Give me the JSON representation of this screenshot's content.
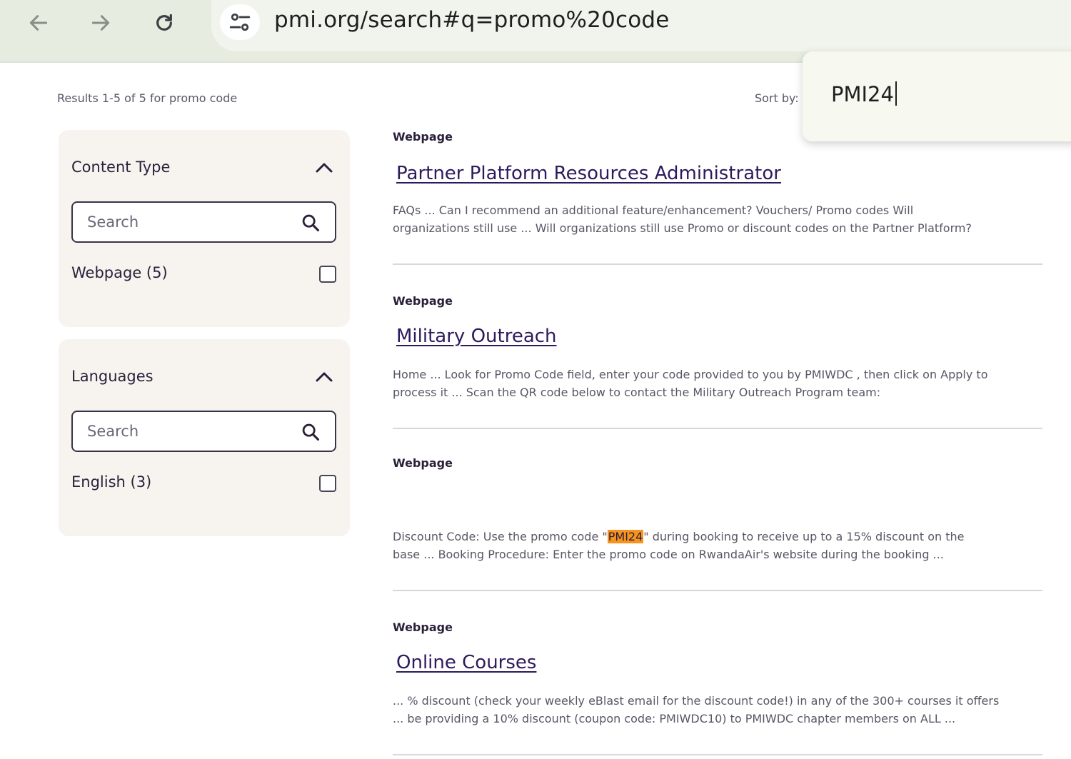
{
  "browser": {
    "url": "pmi.org/search#q=promo%20code",
    "icons": {
      "back": "arrow-left-icon",
      "forward": "arrow-right-icon",
      "reload": "reload-icon",
      "site_info": "tune-icon"
    }
  },
  "autofill": {
    "value": "PMI24"
  },
  "results_header": {
    "count_text": "Results 1-5 of 5 for promo code",
    "sort_label": "Sort by:"
  },
  "facets": [
    {
      "title": "Content Type",
      "search_placeholder": "Search",
      "options": [
        {
          "label": "Webpage (5)",
          "checked": false
        }
      ]
    },
    {
      "title": "Languages",
      "search_placeholder": "Search",
      "options": [
        {
          "label": "English (3)",
          "checked": false
        }
      ]
    }
  ],
  "results": [
    {
      "type": "Webpage",
      "title": "Partner Platform Resources Administrator",
      "snippet_line1": "FAQs ... Can I recommend an additional feature/enhancement? Vouchers/ Promo codes Will",
      "snippet_line2": "organizations still use ... Will organizations still use Promo or discount codes on the Partner Platform?"
    },
    {
      "type": "Webpage",
      "title": "Military Outreach",
      "snippet_line1": "Home ... Look for Promo Code field, enter your code provided to you by PMIWDC , then click on Apply to",
      "snippet_line2": "process it ... Scan the QR code below to contact the Military Outreach Program team:"
    },
    {
      "type": "Webpage",
      "title": "",
      "snippet_pre": "Discount Code: Use the promo code \"",
      "snippet_highlight": "PMI24",
      "snippet_post": "\" during booking to receive up to a 15% discount on the",
      "snippet_line2": "base ... Booking Procedure: Enter the promo code on RwandaAir's website during the booking ..."
    },
    {
      "type": "Webpage",
      "title": "Online Courses",
      "snippet_line1": "... % discount (check your weekly eBlast email for the discount code!) in any of the 300+ courses it offers",
      "snippet_line2": "... be providing a 10% discount (coupon code: PMIWDC10) to PMIWDC chapter members on ALL ..."
    }
  ]
}
